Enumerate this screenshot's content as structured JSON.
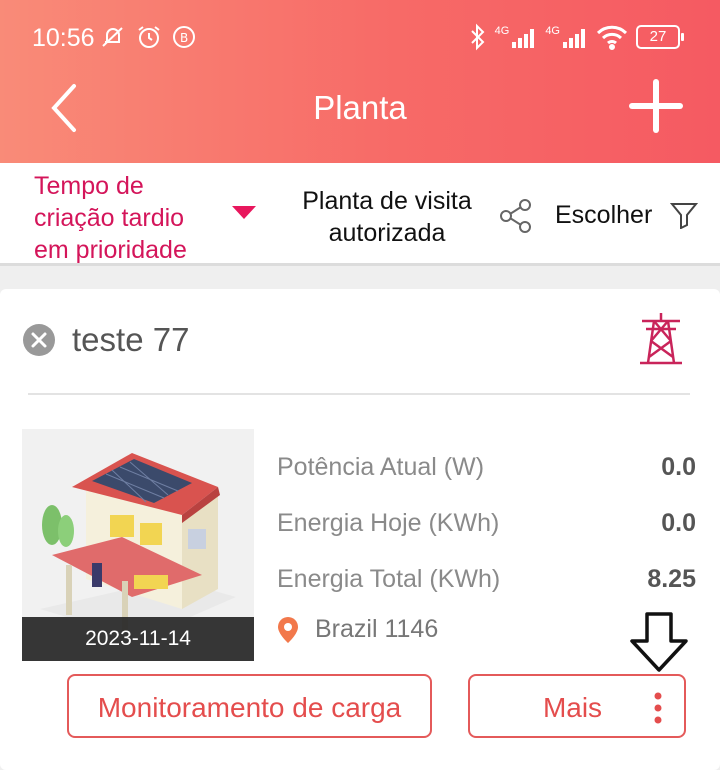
{
  "status_bar": {
    "time": "10:56",
    "battery": "27",
    "network_1": "4G",
    "network_2": "4G"
  },
  "nav": {
    "title": "Planta"
  },
  "filter_bar": {
    "sort_line1": "Tempo de",
    "sort_line2": "criação tardio",
    "sort_line3": "em prioridade",
    "visit_line1": "Planta de visita",
    "visit_line2": "autorizada",
    "choose": "Escolher"
  },
  "plant": {
    "name": "teste 77",
    "date": "2023-11-14",
    "metrics": [
      {
        "label": "Potência Atual (W)",
        "value": "0.0"
      },
      {
        "label": "Energia Hoje (KWh)",
        "value": "0.0"
      },
      {
        "label": "Energia Total (KWh)",
        "value": "8.25"
      }
    ],
    "location": "Brazil 1146"
  },
  "actions": {
    "load_monitoring": "Monitoramento de carga",
    "more": "Mais"
  },
  "colors": {
    "accent": "#e8175d",
    "header_from": "#f98b78",
    "header_to": "#f55a62",
    "button": "#e44d4d",
    "pin": "#f2784b"
  }
}
